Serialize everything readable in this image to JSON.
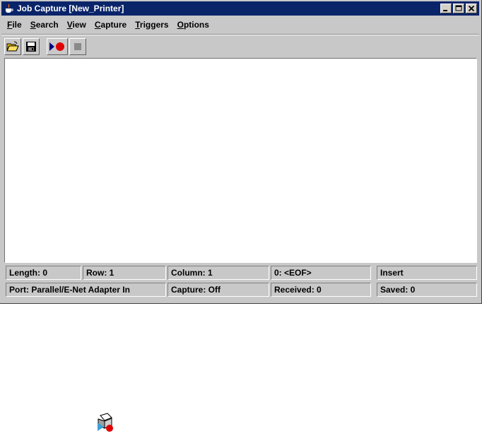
{
  "window": {
    "title": "Job Capture [New_Printer]"
  },
  "menu": [
    {
      "label": "File",
      "key": "F",
      "rest": "ile"
    },
    {
      "label": "Search",
      "key": "S",
      "rest": "earch"
    },
    {
      "label": "View",
      "key": "V",
      "rest": "iew"
    },
    {
      "label": "Capture",
      "key": "C",
      "rest": "apture"
    },
    {
      "label": "Triggers",
      "key": "T",
      "rest": "riggers"
    },
    {
      "label": "Options",
      "key": "O",
      "rest": "ptions"
    }
  ],
  "toolbar": {
    "icons": [
      "open-folder-icon",
      "save-disk-icon",
      "start-capture-icon",
      "stop-capture-icon"
    ]
  },
  "editor": {
    "content": ""
  },
  "status": {
    "length": "Length: 0",
    "row": "Row: 1",
    "column": "Column: 1",
    "char": "0: <EOF>",
    "mode": "Insert",
    "port": "Port: Parallel/E-Net Adapter In",
    "capture": "Capture: Off",
    "received": "Received: 0",
    "saved": "Saved: 0"
  },
  "colors": {
    "titlebar": "#0a246a",
    "window_bg": "#c8c8c8",
    "record_red": "#e00000",
    "play_blue": "#000080"
  }
}
